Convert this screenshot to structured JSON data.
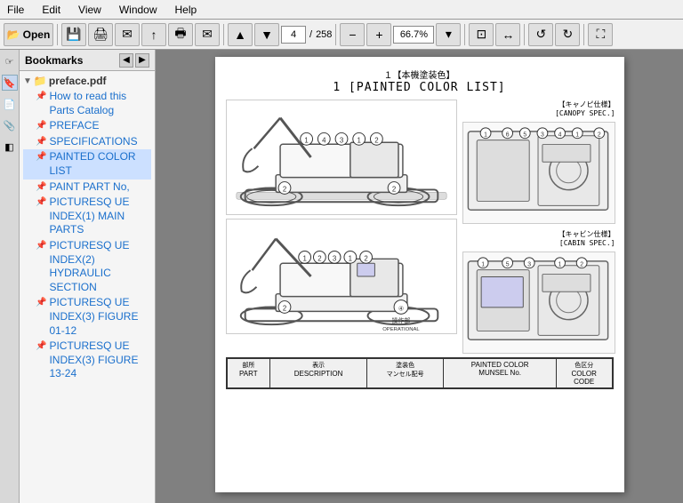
{
  "menubar": {
    "items": [
      "File",
      "Edit",
      "View",
      "Window",
      "Help"
    ]
  },
  "toolbar": {
    "open_label": "Open",
    "page_current": "4",
    "page_total": "258",
    "zoom_value": "66.7%",
    "buttons": [
      "folder-open",
      "save",
      "print-settings",
      "share",
      "upload",
      "print",
      "email",
      "arrow-up",
      "arrow-down",
      "zoom-out",
      "zoom-in",
      "fit-page",
      "fit-width",
      "rotate-left",
      "rotate-right",
      "fullscreen"
    ]
  },
  "sidebar": {
    "title": "Bookmarks",
    "bookmarks": [
      {
        "id": "file",
        "label": "preface.pdf",
        "type": "file"
      },
      {
        "id": "how-to-read",
        "label": "How to read this Parts Catalog",
        "type": "item",
        "active": false
      },
      {
        "id": "preface",
        "label": "PREFACE",
        "type": "item",
        "active": false
      },
      {
        "id": "specifications",
        "label": "SPECIFICATIONS",
        "type": "item",
        "active": false
      },
      {
        "id": "painted-color-list",
        "label": "PAINTED COLOR LIST",
        "type": "item",
        "active": true
      },
      {
        "id": "paint-part-no",
        "label": "PAINT PART No,",
        "type": "item",
        "active": false
      },
      {
        "id": "picturesq-index-1",
        "label": "PICTURESQ UE INDEX(1) MAIN PARTS",
        "type": "item",
        "active": false
      },
      {
        "id": "picturesq-index-2",
        "label": "PICTURESQ UE INDEX(2) HYDRAULIC SECTION",
        "type": "item",
        "active": false
      },
      {
        "id": "picturesq-index-3a",
        "label": "PICTURESQ UE INDEX(3) FIGURE 01-12",
        "type": "item",
        "active": false
      },
      {
        "id": "picturesq-index-3b",
        "label": "PICTURESQ UE INDEX(3) FIGURE 13-24",
        "type": "item",
        "active": false
      }
    ]
  },
  "pdf": {
    "title_jp": "１【本機塗装色】",
    "title_en": "1 [PAINTED COLOR LIST]",
    "canopy_spec_jp": "【キャノピ仕様】",
    "canopy_spec_en": "[CANOPY SPEC.]",
    "cabin_spec_jp": "【キャビン仕様】",
    "cabin_spec_en": "[CABIN SPEC.]",
    "operational_part_jp": "④操作部",
    "operational_part_en": "OPERATIONAL PART",
    "table_headers": [
      {
        "jp": "部所",
        "en": "PART"
      },
      {
        "jp": "表示",
        "en": "DESCRIPTION"
      },
      {
        "jp": "塗装色\nマンセル配号",
        "en": ""
      },
      {
        "jp": "",
        "en": "PAINTED COLOR MUNSEL No."
      },
      {
        "jp": "色区分",
        "en": "COLOR CODE"
      }
    ]
  }
}
